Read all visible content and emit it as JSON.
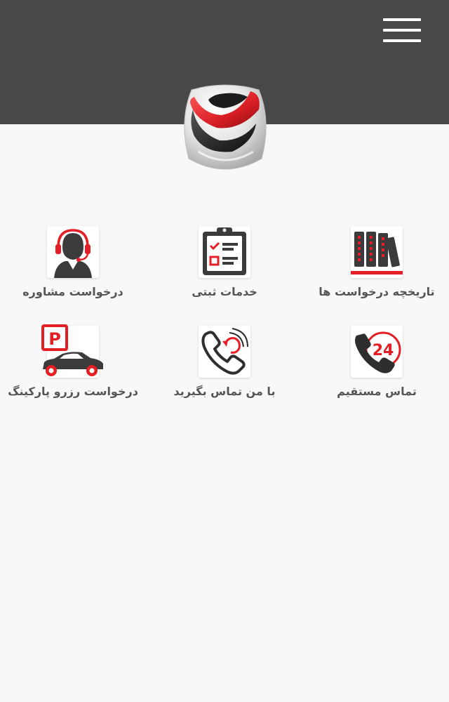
{
  "header": {
    "background": "#484848",
    "menu_icon": "hamburger-menu-icon"
  },
  "logo": {
    "icon": "app-logo-icon",
    "colors": {
      "red": "#d81e25",
      "black": "#1a1a1a",
      "silver": "#d0d0d0"
    }
  },
  "tiles": [
    {
      "label": "تاریخچه درخواست ها",
      "icon": "history-folders-icon"
    },
    {
      "label": "خدمات ثبتی",
      "icon": "clipboard-checklist-icon"
    },
    {
      "label": "درخواست مشاوره",
      "icon": "consultant-headset-icon"
    },
    {
      "label": "تماس مستقیم",
      "icon": "phone-24-icon"
    },
    {
      "label": "با من تماس بگیرید",
      "icon": "callback-phone-icon"
    },
    {
      "label": "درخواست رزرو پارکینگ",
      "icon": "parking-car-icon"
    }
  ],
  "theme": {
    "accent": "#e31e24",
    "icon_dark": "#3b3b3b",
    "label_color": "#555555",
    "background": "#f8f8f8"
  }
}
